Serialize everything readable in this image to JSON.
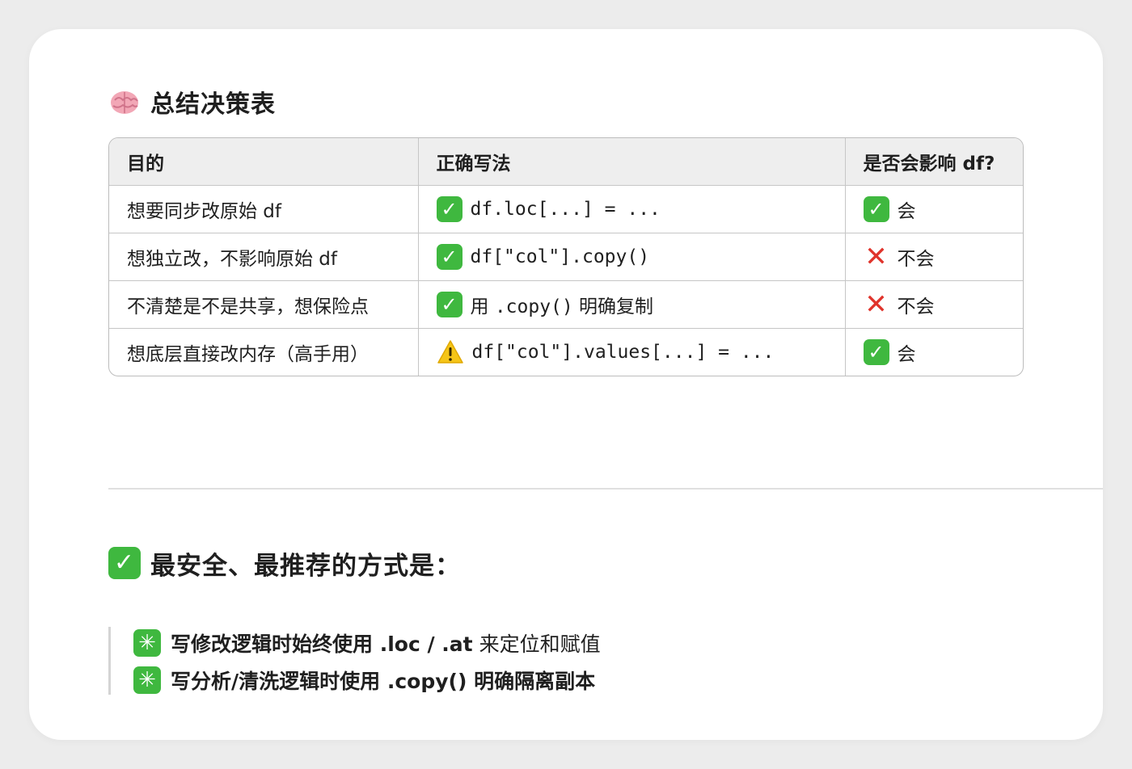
{
  "section1": {
    "icon": "brain-icon",
    "title": "总结决策表"
  },
  "table": {
    "headers": [
      "目的",
      "正确写法",
      "是否会影响 df?"
    ],
    "rows": [
      {
        "purpose": "想要同步改原始 df",
        "method_icon": "check-icon",
        "method": "df.loc[...] = ...",
        "method_mono": true,
        "effect_icon": "check-icon",
        "effect": "会"
      },
      {
        "purpose": "想独立改，不影响原始 df",
        "method_icon": "check-icon",
        "method": "df[\"col\"].copy()",
        "method_mono": true,
        "effect_icon": "cross-icon",
        "effect": "不会"
      },
      {
        "purpose": "不清楚是不是共享，想保险点",
        "method_icon": "check-icon",
        "method_prefix": "用 ",
        "method_code": ".copy()",
        "method_suffix": " 明确复制",
        "effect_icon": "cross-icon",
        "effect": "不会"
      },
      {
        "purpose": "想底层直接改内存（高手用）",
        "method_icon": "warning-icon",
        "method": "df[\"col\"].values[...] = ...",
        "method_mono": true,
        "effect_icon": "check-icon",
        "effect": "会"
      }
    ]
  },
  "section2": {
    "icon": "check-icon",
    "title": "最安全、最推荐的方式是："
  },
  "quote": {
    "lines": [
      {
        "icon": "sparkle-icon",
        "bold": "写修改逻辑时始终使用 .loc / .at",
        "normal": " 来定位和赋值"
      },
      {
        "icon": "sparkle-icon",
        "bold": "写分析/清洗逻辑时使用 .copy() 明确隔离副本",
        "normal": ""
      }
    ]
  },
  "colors": {
    "check_green": "#3fb83f",
    "cross_red": "#e0332b",
    "warning_yellow": "#f5c518",
    "header_bg": "#eeeeee"
  }
}
